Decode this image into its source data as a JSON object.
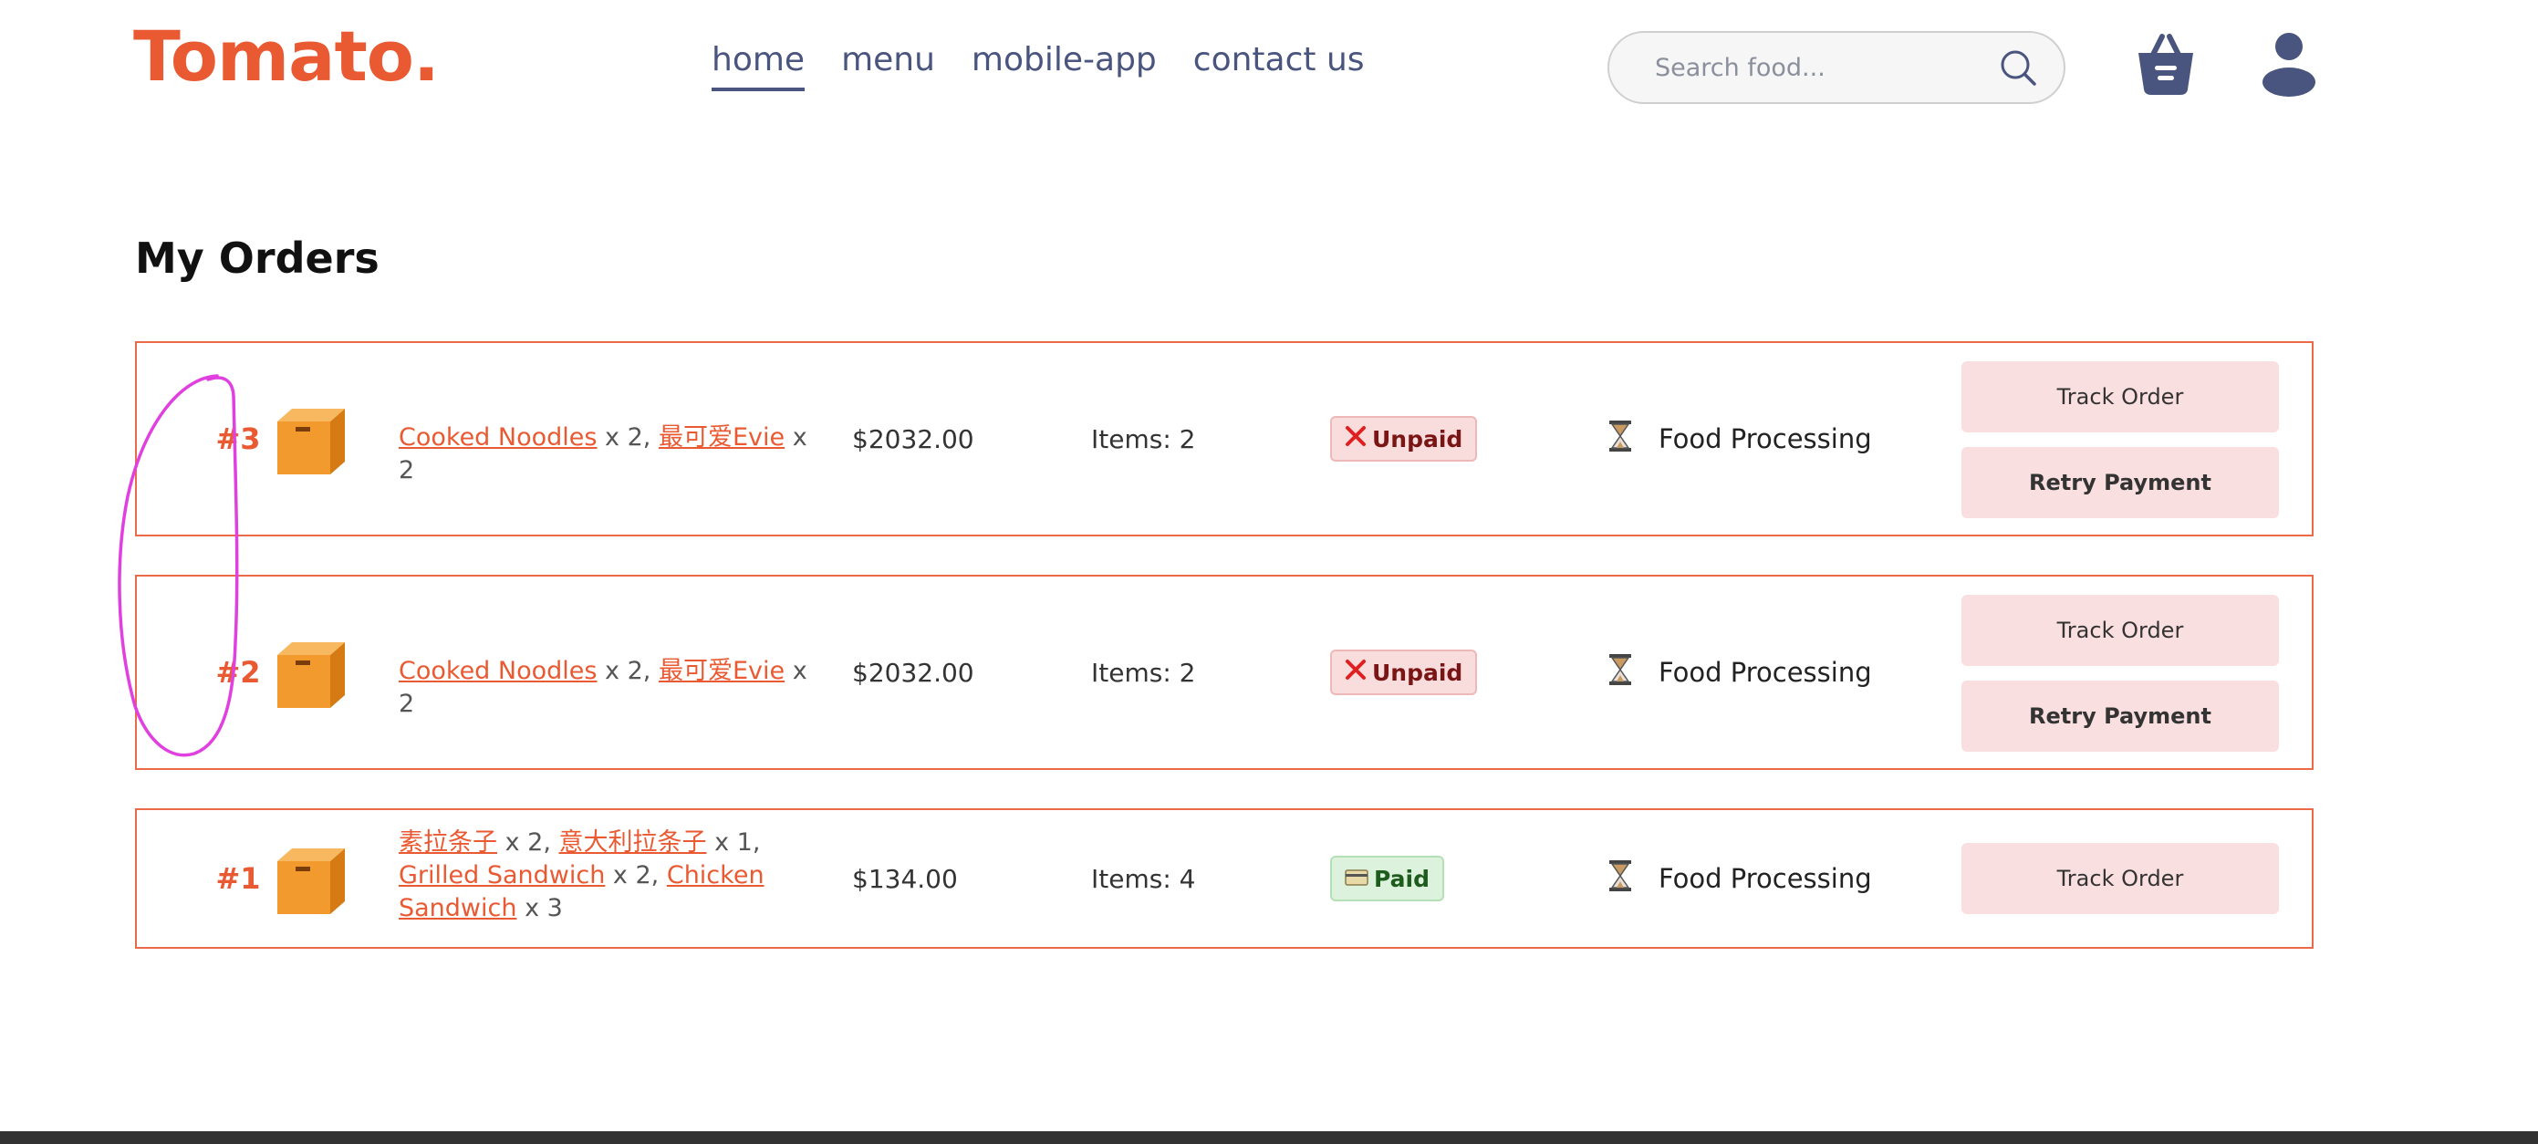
{
  "header": {
    "logo": "Tomato.",
    "nav": [
      {
        "label": "home",
        "active": true
      },
      {
        "label": "menu",
        "active": false
      },
      {
        "label": "mobile-app",
        "active": false
      },
      {
        "label": "contact us",
        "active": false
      }
    ],
    "search": {
      "placeholder": "Search food...",
      "icon": "search-icon"
    },
    "basket_icon": "basket-icon",
    "profile_icon": "profile-icon"
  },
  "page_title": "My Orders",
  "orders": [
    {
      "number": "#3",
      "items": [
        {
          "name": "Cooked Noodles",
          "qty": " x 2, "
        },
        {
          "name": "最可爱Evie",
          "qty": " x 2"
        }
      ],
      "price": "$2032.00",
      "count": "Items: 2",
      "status_icon": "cross-icon",
      "status": "Unpaid",
      "processing_icon": "hourglass-icon",
      "processing": "Food Processing",
      "buttons": [
        "Track Order",
        "Retry Payment"
      ]
    },
    {
      "number": "#2",
      "items": [
        {
          "name": "Cooked Noodles",
          "qty": " x 2, "
        },
        {
          "name": "最可爱Evie",
          "qty": " x 2"
        }
      ],
      "price": "$2032.00",
      "count": "Items: 2",
      "status_icon": "cross-icon",
      "status": "Unpaid",
      "processing_icon": "hourglass-icon",
      "processing": "Food Processing",
      "buttons": [
        "Track Order",
        "Retry Payment"
      ]
    },
    {
      "number": "#1",
      "items": [
        {
          "name": "素拉条子",
          "qty": " x 2, "
        },
        {
          "name": "意大利拉条子",
          "qty": " x 1, "
        },
        {
          "name": "Grilled Sandwich",
          "qty": " x 2, "
        },
        {
          "name": "Chicken Sandwich",
          "qty": " x 3"
        }
      ],
      "price": "$134.00",
      "count": "Items: 4",
      "status_icon": "credit-card-icon",
      "status": "Paid",
      "processing_icon": "hourglass-icon",
      "processing": "Food Processing",
      "buttons": [
        "Track Order"
      ]
    }
  ],
  "colors": {
    "brand": "#ea5a32",
    "nav": "#49557e",
    "button_bg": "#fadfe0",
    "annotation": "#e040e0"
  }
}
